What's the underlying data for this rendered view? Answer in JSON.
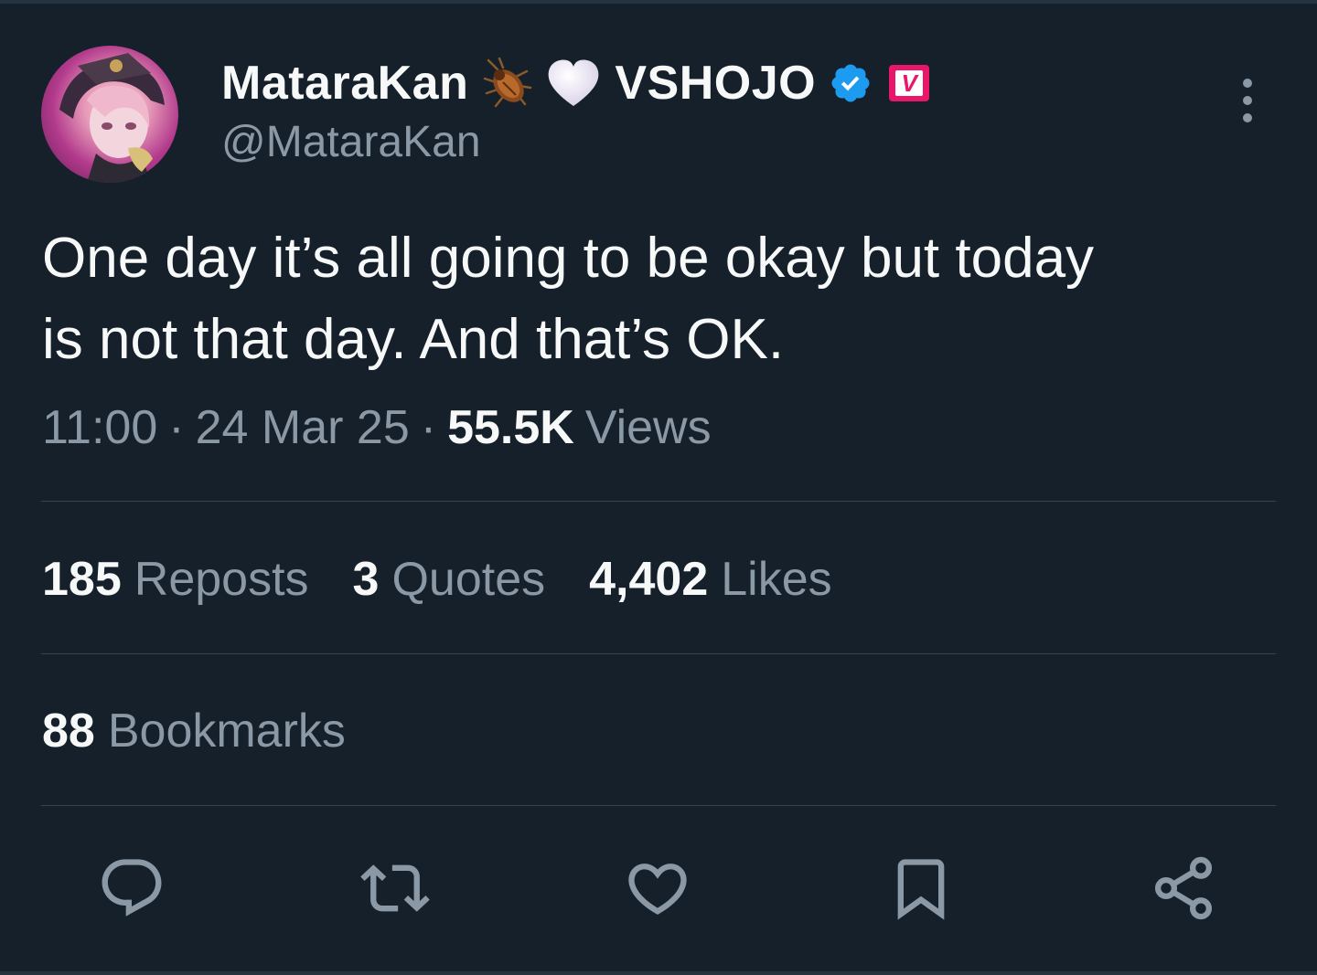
{
  "author": {
    "display_name": "MataraKan",
    "emojis": [
      "cockroach-icon",
      "white-heart-icon"
    ],
    "affiliation": "VSHOJO",
    "verified": true,
    "badge_letter": "V",
    "handle": "@MataraKan",
    "colors": {
      "verified": "#1d9bf0",
      "badge": "#e8176a"
    }
  },
  "tweet": {
    "text": "One day it’s all going to be okay but today\nis not that day. And that’s OK.",
    "time": "11:00",
    "separator": "·",
    "date": "24 Mar 25",
    "views_count": "55.5K",
    "views_label": "Views"
  },
  "stats": {
    "reposts": {
      "count": "185",
      "label": "Reposts"
    },
    "quotes": {
      "count": "3",
      "label": "Quotes"
    },
    "likes": {
      "count": "4,402",
      "label": "Likes"
    },
    "bookmarks": {
      "count": "88",
      "label": "Bookmarks"
    }
  },
  "actions": [
    "reply-icon",
    "repost-icon",
    "like-icon",
    "bookmark-icon",
    "share-icon"
  ],
  "theme": {
    "background": "#15202b",
    "text": "#f7f9f9",
    "muted": "#8b98a5",
    "divider": "#38444d"
  }
}
